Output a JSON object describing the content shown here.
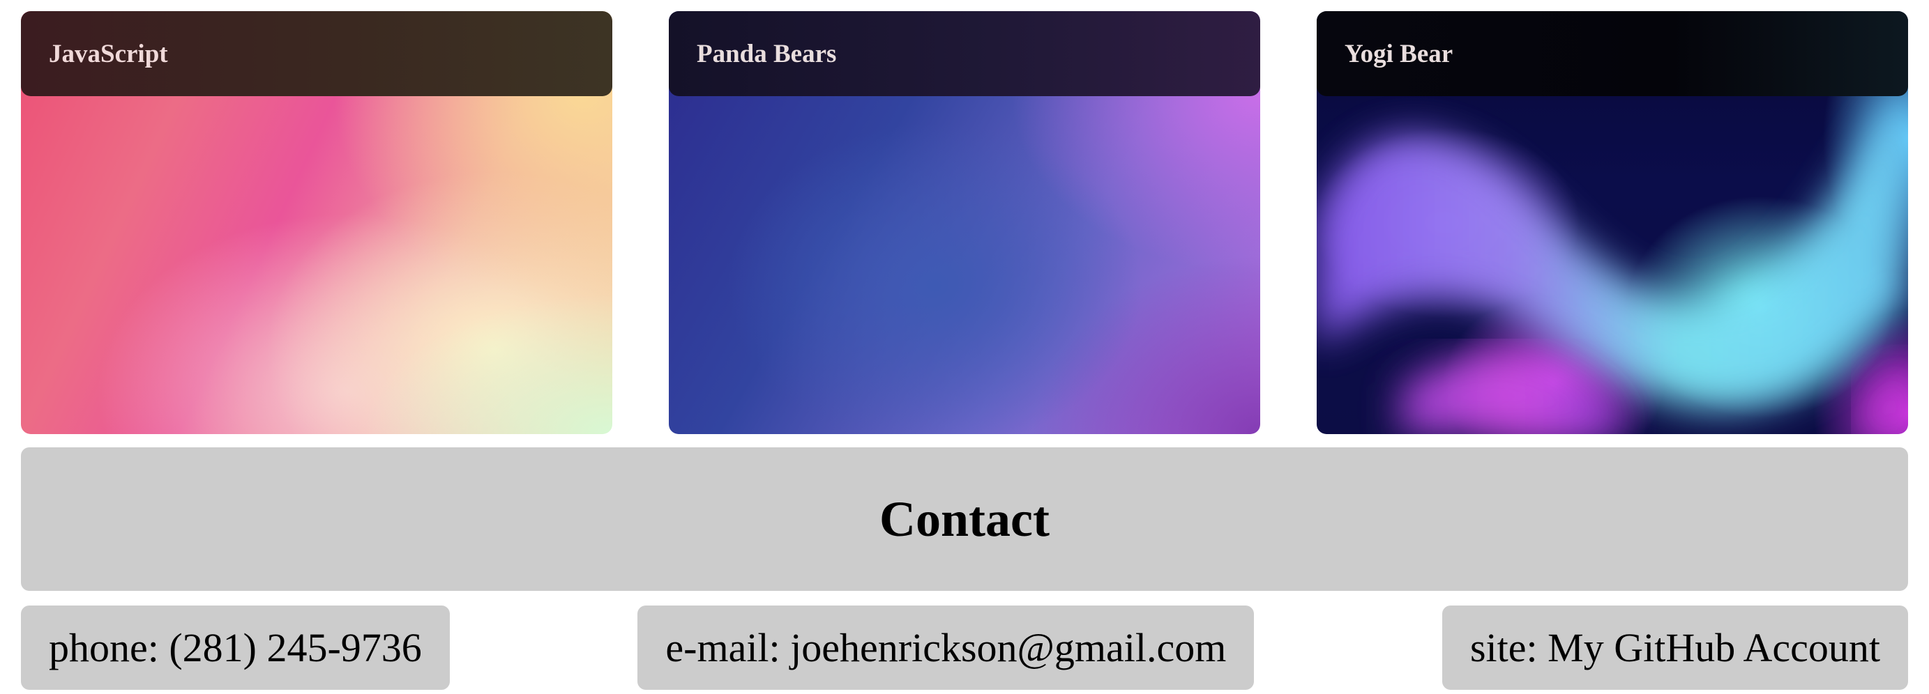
{
  "cards": [
    {
      "title": "JavaScript"
    },
    {
      "title": "Panda Bears"
    },
    {
      "title": "Yogi Bear"
    }
  ],
  "contact": {
    "heading": "Contact",
    "phone": {
      "label": "phone:",
      "value": "(281) 245-9736"
    },
    "email": {
      "label": "e-mail:",
      "value": "joehenrickson@gmail.com"
    },
    "site": {
      "label": "site:",
      "value": "My GitHub Account"
    }
  },
  "colors": {
    "panel_gray": "#cccccc",
    "text": "#000000",
    "card_title": "#e9dede"
  }
}
